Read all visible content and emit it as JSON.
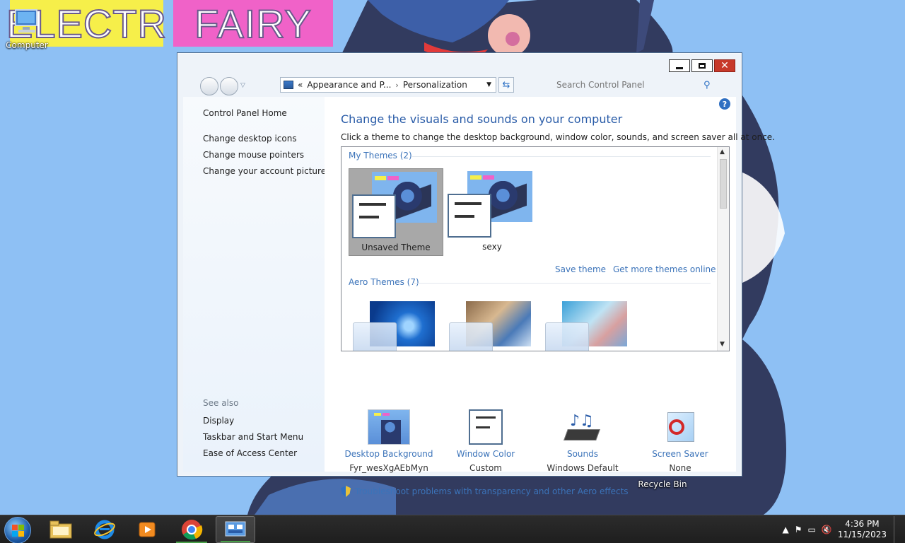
{
  "desktop": {
    "banner_left": "ELECTR",
    "banner_right": "FAIRY",
    "icons": {
      "computer": "Computer",
      "recycle_bin": "Recycle Bin"
    }
  },
  "window": {
    "breadcrumb": {
      "prefix": "«",
      "parent": "Appearance and P...",
      "current": "Personalization"
    },
    "search_placeholder": "Search Control Panel",
    "left_nav": {
      "home": "Control Panel Home",
      "links": [
        "Change desktop icons",
        "Change mouse pointers",
        "Change your account picture"
      ],
      "see_also_heading": "See also",
      "see_also": [
        "Display",
        "Taskbar and Start Menu",
        "Ease of Access Center"
      ]
    },
    "main": {
      "title": "Change the visuals and sounds on your computer",
      "description": "Click a theme to change the desktop background, window color, sounds, and screen saver all at once.",
      "my_themes_heading": "My Themes (2)",
      "my_themes": [
        {
          "name": "Unsaved Theme",
          "selected": true
        },
        {
          "name": "sexy",
          "selected": false
        }
      ],
      "save_theme": "Save theme",
      "get_more": "Get more themes online",
      "aero_heading": "Aero Themes (7)",
      "bottom": [
        {
          "title": "Desktop Background",
          "value": "Fyr_wesXgAEbMyn"
        },
        {
          "title": "Window Color",
          "value": "Custom"
        },
        {
          "title": "Sounds",
          "value": "Windows Default"
        },
        {
          "title": "Screen Saver",
          "value": "None"
        }
      ],
      "troubleshoot": "Troubleshoot problems with transparency and other Aero effects"
    }
  },
  "taskbar": {
    "time": "4:36 PM",
    "date": "11/15/2023"
  },
  "colors": {
    "link": "#3b73b9",
    "title": "#2a5ca8",
    "wallpaper": "#8ec0f4",
    "taskbar": "#1e1e1e"
  }
}
